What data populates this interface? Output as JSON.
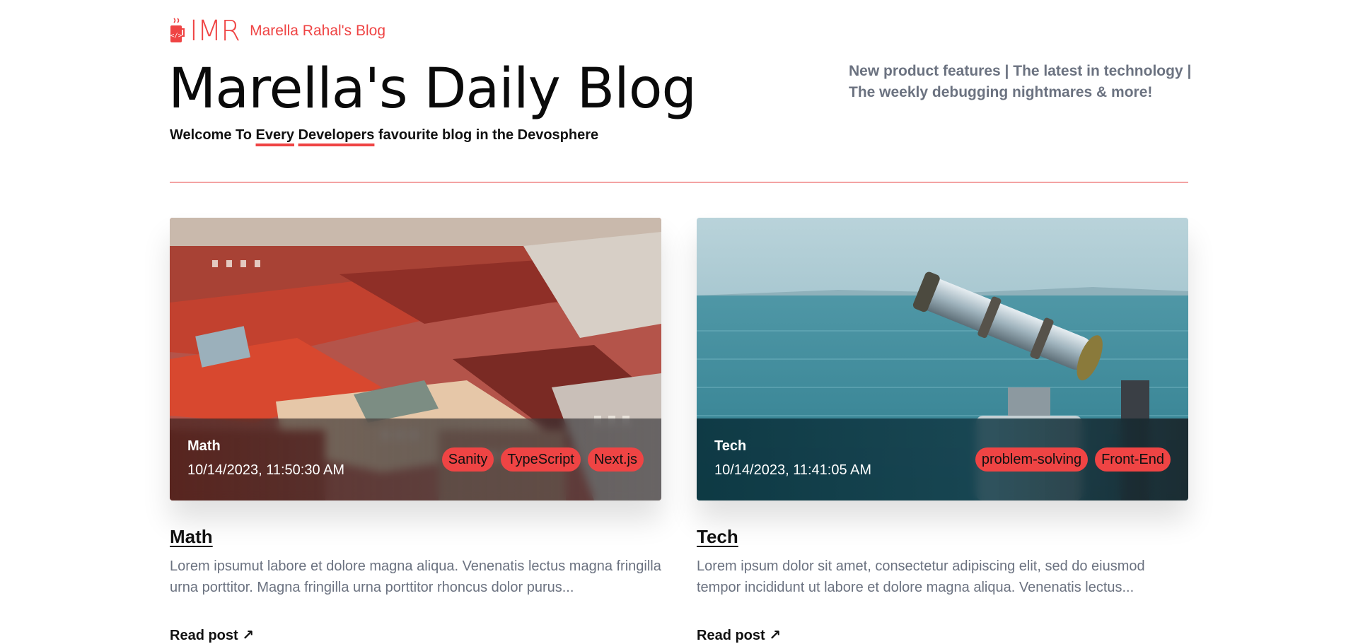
{
  "header": {
    "brand_mark": "IMR",
    "blog_name": "Marella Rahal's Blog",
    "title": "Marella's Daily Blog",
    "welcome": {
      "prefix": "Welcome To ",
      "word1": "Every",
      "space1": " ",
      "word2": "Developers",
      "suffix": " favourite blog in the Devosphere"
    },
    "tagline": "New product features | The latest in technology | The weekly debugging nightmares & more!"
  },
  "posts": [
    {
      "category": "Math",
      "date": "10/14/2023, 11:50:30 AM",
      "tags": [
        "Sanity",
        "TypeScript",
        "Next.js"
      ],
      "title": "Math",
      "description": "Lorem ipsumut labore et dolore magna aliqua. Venenatis lectus magna fringilla urna porttitor. Magna fringilla urna porttitor rhoncus dolor purus...",
      "read_more": "Read post ↗"
    },
    {
      "category": "Tech",
      "date": "10/14/2023, 11:41:05 AM",
      "tags": [
        "problem-solving",
        "Front-End"
      ],
      "title": "Tech",
      "description": "Lorem ipsum dolor sit amet, consectetur adipiscing elit, sed do eiusmod tempor incididunt ut labore et dolore magna aliqua. Venenatis lectus...",
      "read_more": "Read post ↗"
    }
  ],
  "colors": {
    "accent": "#ef4444",
    "muted": "#6b7280"
  }
}
